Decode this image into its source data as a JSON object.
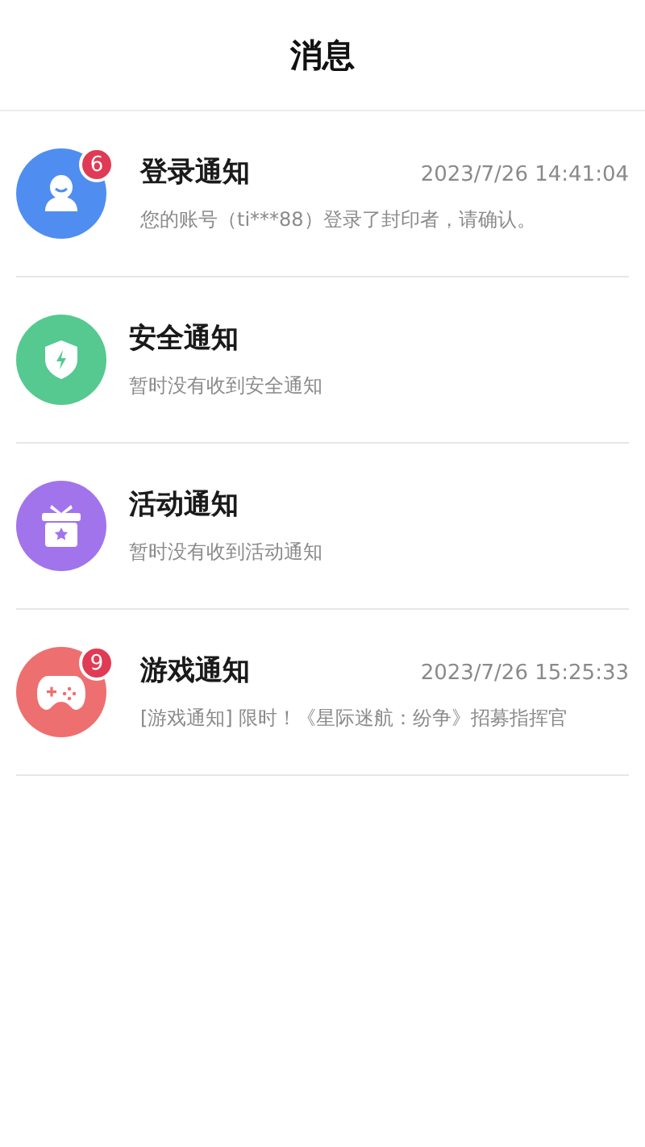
{
  "header": {
    "title": "消息"
  },
  "notifications": [
    {
      "kind": "user",
      "color": "#4f8ef0",
      "badge": "6",
      "title": "登录通知",
      "time": "2023/7/26 14:41:04",
      "preview": "您的账号（ti***88）登录了封印者，请确认。"
    },
    {
      "kind": "shield",
      "color": "#55c98f",
      "title": "安全通知",
      "preview": "暂时没有收到安全通知"
    },
    {
      "kind": "gift",
      "color": "#a174ec",
      "title": "活动通知",
      "preview": "暂时没有收到活动通知"
    },
    {
      "kind": "gamepad",
      "color": "#ee6f6f",
      "badge": "9",
      "title": "游戏通知",
      "time": "2023/7/26 15:25:33",
      "preview": "[游戏通知] 限时！《星际迷航：纷争》招募指挥官"
    }
  ]
}
